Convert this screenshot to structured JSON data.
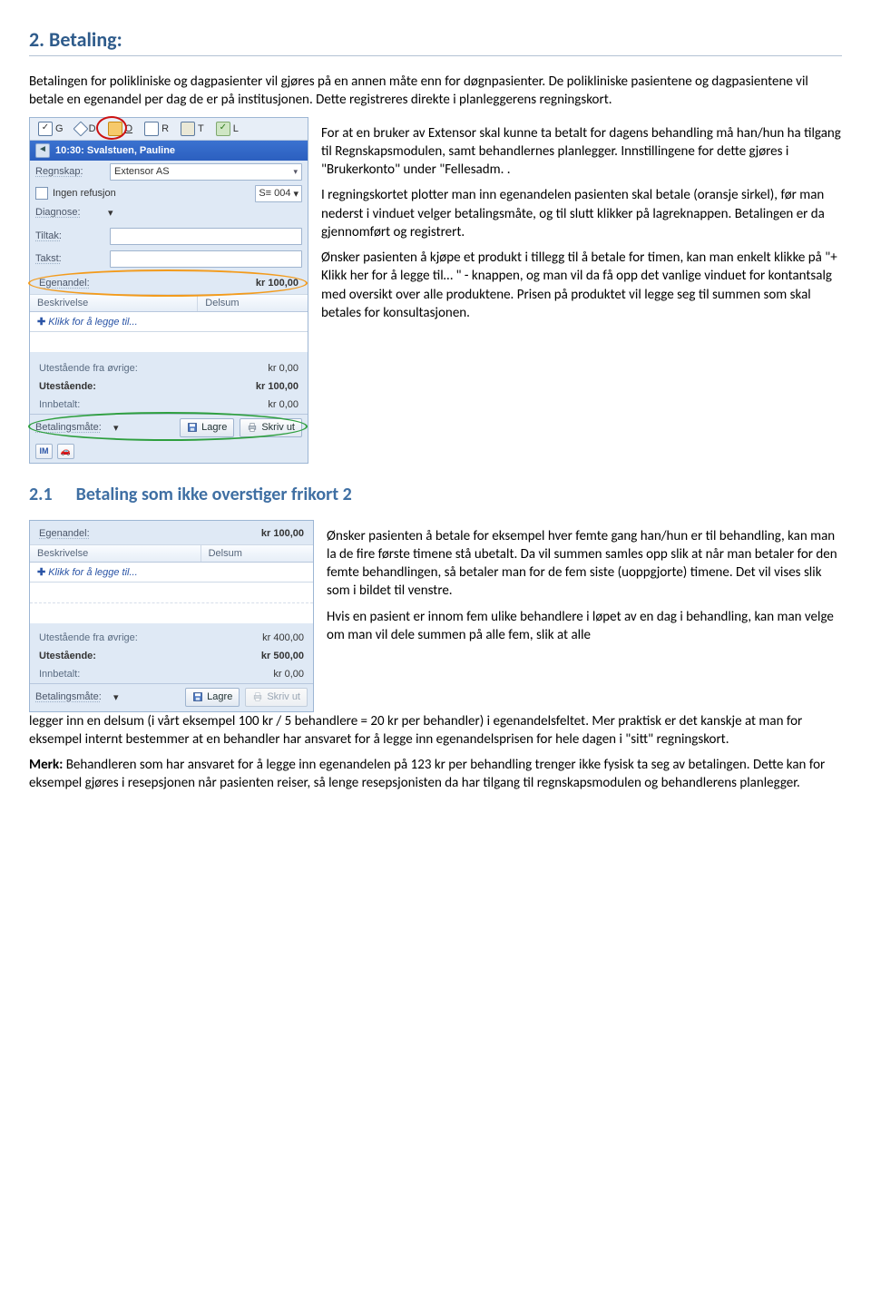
{
  "title": "2. Betaling:",
  "intro": "Betalingen for polikliniske og dagpasienter vil gjøres på en annen måte enn for døgnpasienter. De polikliniske pasientene og dagpasientene vil betale en egenandel per dag de er på institusjonen. Dette registreres direkte i planleggerens regningskort.",
  "panel1": {
    "tabs": {
      "g": "G",
      "d": "D",
      "o": "O",
      "r": "R",
      "t": "T",
      "l": "L"
    },
    "appointment": "10:30: Svalstuen, Pauline",
    "regnskap_label": "Regnskap:",
    "regnskap_value": "Extensor AS",
    "ingenref": "Ingen refusjon",
    "s_label": "S≡",
    "s_val": "004",
    "diagnose_label": "Diagnose:",
    "tiltak_label": "Tiltak:",
    "takst_label": "Takst:",
    "egenandel_label": "Egenandel:",
    "egenandel_val": "kr 100,00",
    "col_besk": "Beskrivelse",
    "col_del": "Delsum",
    "addline": "Klikk for å legge til...",
    "ute_ovrige_label": "Utestående fra øvrige:",
    "ute_ovrige": "kr 0,00",
    "ute_label": "Utestående:",
    "ute": "kr 100,00",
    "innb_label": "Innbetalt:",
    "innb": "kr 0,00",
    "betm_label": "Betalingsmåte:",
    "lagre": "Lagre",
    "skriv": "Skriv ut",
    "foot_im": "IM"
  },
  "para1": "For at en bruker av Extensor skal kunne ta betalt for dagens behandling må han/hun ha tilgang til Regnskapsmodulen, samt behandlernes planlegger. Innstillingene for dette gjøres i \"Brukerkonto\" under \"Fellesadm. .",
  "para2": "I regningskortet plotter man inn egenandelen pasienten skal betale (oransje sirkel), før man nederst i vinduet velger betalingsmåte, og til slutt klikker på lagreknappen. Betalingen er da gjennomført og registrert.",
  "para3": "Ønsker pasienten å kjøpe et produkt i tillegg til å betale for timen, kan man enkelt klikke på \"+ Klikk her for å legge til… \" - knappen, og man vil da få opp det vanlige vinduet for kontantsalg med oversikt over alle produktene. Prisen på produktet vil legge seg til summen som skal betales for konsultasjonen.",
  "h2_num": "2.1",
  "h2": "Betaling som ikke overstiger frikort 2",
  "panel2": {
    "egenandel_label": "Egenandel:",
    "egenandel_val": "kr 100,00",
    "col_besk": "Beskrivelse",
    "col_del": "Delsum",
    "addline": "Klikk for å legge til...",
    "ute_ovrige_label": "Utestående fra øvrige:",
    "ute_ovrige": "kr 400,00",
    "ute_label": "Utestående:",
    "ute": "kr 500,00",
    "innb_label": "Innbetalt:",
    "innb": "kr 0,00",
    "betm_label": "Betalingsmåte:",
    "lagre": "Lagre",
    "skriv": "Skriv ut"
  },
  "para4": "Ønsker pasienten å betale for eksempel hver femte gang han/hun er til behandling, kan man la de fire første timene stå ubetalt. Da vil summen samles opp slik at når man betaler for den femte behandlingen, så betaler man for de fem siste (uoppgjorte) timene.  Det vil vises slik som i bildet til venstre.",
  "para5a": "Hvis en pasient er innom fem ulike behandlere i løpet av en dag i behandling, kan man velge om man vil dele summen på alle fem, slik at alle",
  "para5b": "legger inn en delsum (i vårt eksempel 100 kr / 5 behandlere = 20 kr per behandler) i egenandelsfeltet. Mer praktisk er det kanskje at man for eksempel internt bestemmer at en behandler har ansvaret for å legge inn egenandelsprisen for hele dagen i \"sitt\" regningskort.",
  "merk_label": "Merk:",
  "merk": " Behandleren som har ansvaret for å legge inn egenandelen på 123 kr per behandling trenger ikke fysisk ta seg av betalingen. Dette kan for eksempel gjøres i resepsjonen når pasienten reiser, så lenge resepsjonisten da har tilgang til regnskapsmodulen og behandlerens planlegger."
}
